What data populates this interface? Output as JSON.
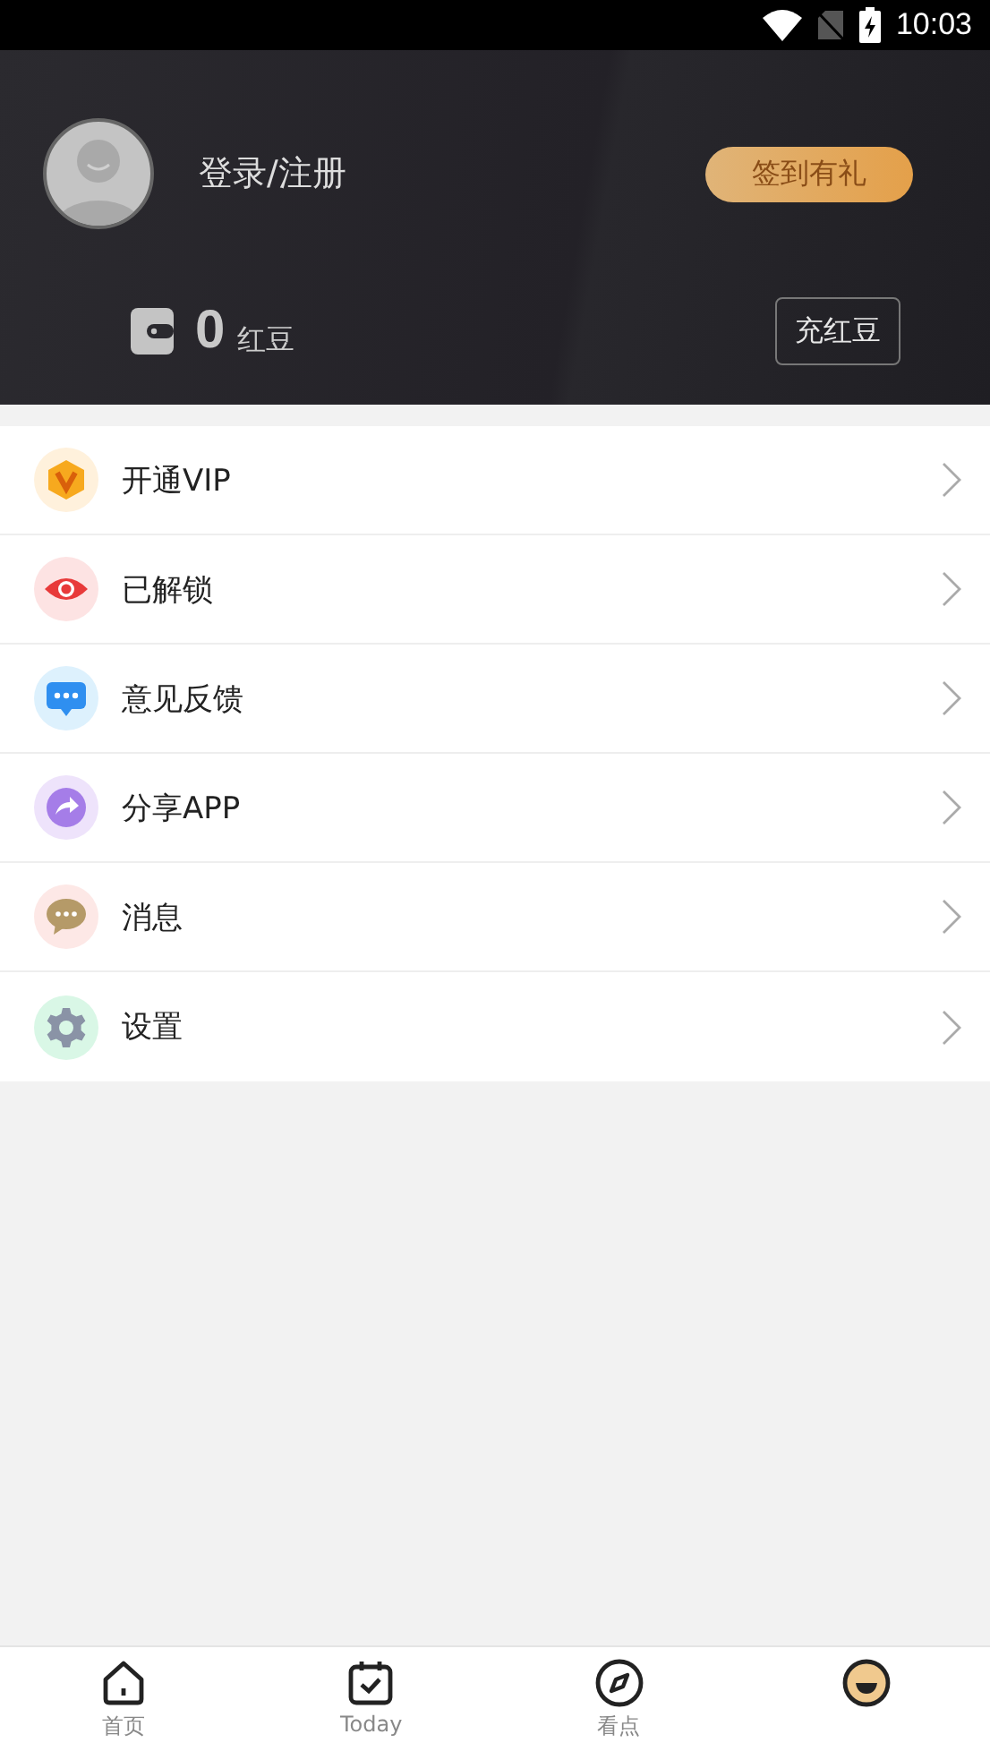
{
  "status_bar": {
    "time": "10:03"
  },
  "profile": {
    "login": "登录/注册",
    "checkin_button": "签到有礼",
    "balance": "0",
    "balance_unit": "红豆",
    "recharge_button": "充红豆"
  },
  "menu": [
    {
      "label": "开通VIP"
    },
    {
      "label": "已解锁"
    },
    {
      "label": "意见反馈"
    },
    {
      "label": "分享APP"
    },
    {
      "label": "消息"
    },
    {
      "label": "设置"
    }
  ],
  "tabs": [
    {
      "label": "首页",
      "selected": false
    },
    {
      "label": "Today",
      "selected": false
    },
    {
      "label": "看点",
      "selected": false
    },
    {
      "selected": true
    }
  ]
}
